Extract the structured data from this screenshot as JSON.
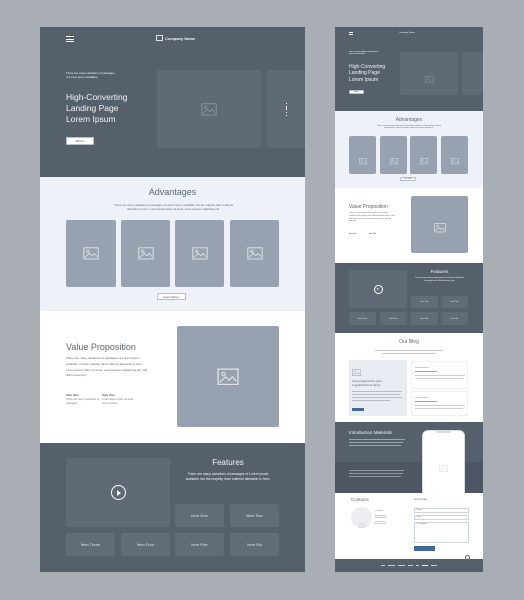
{
  "colors": {
    "dark": "#56606d",
    "light": "#eef1f7",
    "placeholder": "#97a1b0",
    "accent": "#3f6a9a",
    "background": "#a9adb4"
  },
  "icons": {
    "menu": "hamburger-icon",
    "logo": "image-icon",
    "image": "image-icon",
    "play": "play-icon",
    "dots": "vertical-dots-icon"
  },
  "header": {
    "company": "Company Name"
  },
  "hero": {
    "intro": "There are many variations of passages of Lorem Ipsum available.",
    "title_lines": [
      "High-Converting",
      "Landing Page",
      "Lorem Ipsum"
    ],
    "button": "Button"
  },
  "advantages": {
    "title": "Advantages",
    "text": "There are many variations of passages of Lorem Ipsum available, but the majority have suffered alteration in form. Lorem ipsum dolor sit amet, cons ectetuer adipiscing elit.",
    "button": "Learn More ›"
  },
  "value": {
    "title": "Value Proposition",
    "text": "There are many variations of passages of Lorem Ipsum available, but the majority have suffered alteration in form. Lorem ipsum dolor sit amet, cons ectetuer adipiscing elit. sed diam nonummy",
    "items": [
      {
        "title": "Item One",
        "text": "There are many variations of passages"
      },
      {
        "title": "Item Two",
        "text": "Lorem ipsum dolor sit amet, cons ectetuer"
      }
    ]
  },
  "features": {
    "title": "Features",
    "text": "There are many variations of passages of Lorem Ipsum available, but the majority have suffered alteration in form.",
    "items": [
      "Item One",
      "Item Two",
      "Item Three",
      "Item Four",
      "Item Five",
      "Item Six"
    ]
  },
  "blog": {
    "title": "Our Blog",
    "post_title": "Going against the grain, AngelPlanKit its demo"
  },
  "intro": {
    "title": "Introduction Materials"
  },
  "contacts": {
    "title": "Contacts",
    "form_title": "Send a mail",
    "name": "Name",
    "email": "Email",
    "message": "Your Message"
  }
}
